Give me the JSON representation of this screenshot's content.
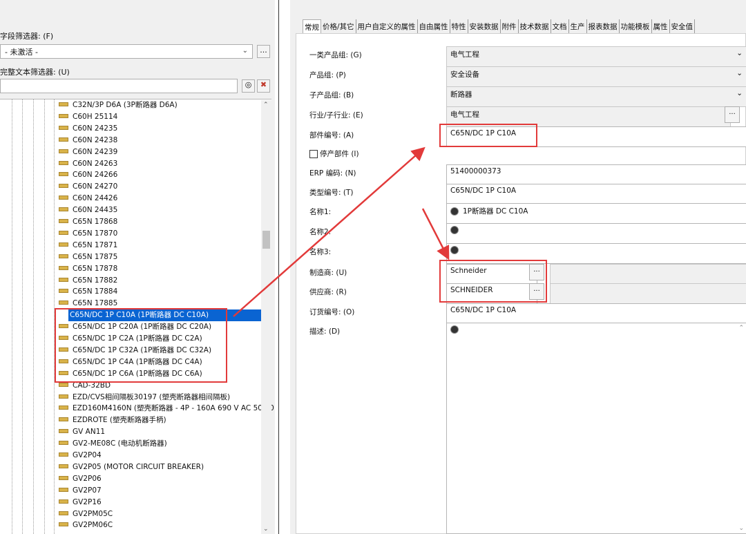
{
  "left": {
    "field_filter_label": "字段筛选器: (F)",
    "field_filter_value": "- 未激活 -",
    "text_filter_label": "完整文本筛选器: (U)",
    "text_filter_value": "",
    "more_button": "...",
    "tree_items": [
      "C32N/3P D6A (3P断路器 D6A)",
      "C60H 25114",
      "C60N 24235",
      "C60N 24238",
      "C60N 24239",
      "C60N 24263",
      "C60N 24266",
      "C60N 24270",
      "C60N 24426",
      "C60N 24435",
      "C65N 17868",
      "C65N 17870",
      "C65N 17871",
      "C65N 17875",
      "C65N 17878",
      "C65N 17882",
      "C65N 17884",
      "C65N 17885",
      "C65N/DC 1P C10A (1P断路器 DC C10A)",
      "C65N/DC 1P C20A (1P断路器 DC C20A)",
      "C65N/DC 1P C2A (1P断路器 DC C2A)",
      "C65N/DC 1P C32A (1P断路器 DC C32A)",
      "C65N/DC 1P C4A (1P断路器 DC C4A)",
      "C65N/DC 1P C6A (1P断路器 DC C6A)",
      "CAD-32BD",
      "EZD/CVS相间隔板30197 (塑壳断路器相间隔板)",
      "EZD160M4160N (塑壳断路器 - 4P - 160A 690 V AC 50/60",
      "EZDROTE (塑壳断路器手柄)",
      "GV AN11",
      "GV2-ME08C (电动机断路器)",
      "GV2P04",
      "GV2P05 (MOTOR CIRCUIT BREAKER)",
      "GV2P06",
      "GV2P07",
      "GV2P16",
      "GV2PM05C",
      "GV2PM06C"
    ],
    "selected_index": 18
  },
  "tabs": [
    "常规",
    "价格/其它",
    "用户自定义的属性",
    "自由属性",
    "特性",
    "安装数据",
    "附件",
    "技术数据",
    "文档",
    "生产",
    "报表数据",
    "功能模板",
    "属性",
    "安全值"
  ],
  "form": {
    "product_group1_label": "一类产品组: (G)",
    "product_group1_value": "电气工程",
    "product_group_label": "产品组: (P)",
    "product_group_value": "安全设备",
    "sub_group_label": "子产品组: (B)",
    "sub_group_value": "断路器",
    "industry_label": "行业/子行业: (E)",
    "industry_value": "电气工程",
    "part_number_label": "部件编号: (A)",
    "part_number_value": "C65N/DC 1P C10A",
    "discontinued_label": "停产部件 (I)",
    "erp_label": "ERP 编码: (N)",
    "erp_value": "51400000373",
    "type_number_label": "类型编号: (T)",
    "type_number_value": "C65N/DC 1P C10A",
    "name1_label": "名称1:",
    "name1_value": "1P断路器 DC C10A",
    "name2_label": "名称2:",
    "name2_value": "",
    "name3_label": "名称3:",
    "name3_value": "",
    "manufacturer_label": "制造商: (U)",
    "manufacturer_value": "Schneider",
    "supplier_label": "供应商: (R)",
    "supplier_value": "SCHNEIDER",
    "order_number_label": "订货编号: (O)",
    "order_number_value": "C65N/DC 1P C10A",
    "description_label": "描述: (D)",
    "description_value": "",
    "ellipsis": "..."
  },
  "colors": {
    "highlight": "#e23a3a",
    "selection": "#0a64d2"
  }
}
